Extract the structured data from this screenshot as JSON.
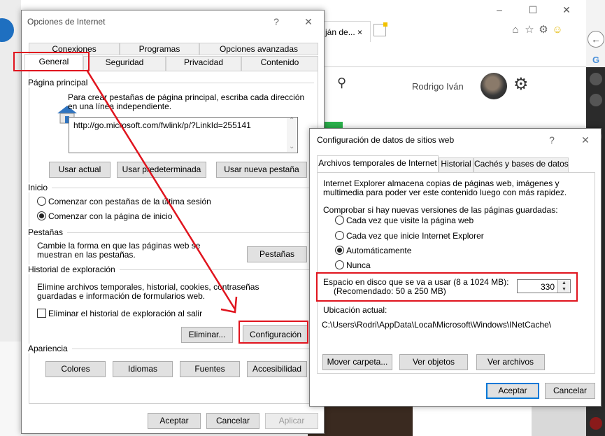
{
  "background": {
    "tab_label": "ján de... ×",
    "user_name": "Rodrigo Iván",
    "window_controls": {
      "minimize": "–",
      "maximize": "☐",
      "close": "✕"
    },
    "toolbar_icons": [
      "home-icon",
      "star-icon",
      "gear-icon",
      "smiley-icon"
    ]
  },
  "internet_options": {
    "title": "Opciones de Internet",
    "help": "?",
    "close": "✕",
    "tabs_row1": [
      "Conexiones",
      "Programas",
      "Opciones avanzadas"
    ],
    "tabs_row2": [
      "General",
      "Seguridad",
      "Privacidad",
      "Contenido"
    ],
    "home": {
      "group": "Página principal",
      "description_line1": "Para crear pestañas de página principal, escriba cada dirección",
      "description_line2": "en una línea independiente.",
      "url": "http://go.microsoft.com/fwlink/p/?LinkId=255141",
      "btn_current": "Usar actual",
      "btn_default": "Usar predeterminada",
      "btn_new_tab": "Usar nueva pestaña"
    },
    "startup": {
      "group": "Inicio",
      "option_last": "Comenzar con pestañas de la última sesión",
      "option_home": "Comenzar con la página de inicio"
    },
    "tabs_section": {
      "group": "Pestañas",
      "description_line1": "Cambie la forma en que las páginas web se",
      "description_line2": "muestran en las pestañas.",
      "btn": "Pestañas"
    },
    "history": {
      "group": "Historial de exploración",
      "description_line1": "Elimine archivos temporales, historial, cookies, contraseñas",
      "description_line2": "guardadas e información de formularios web.",
      "checkbox": "Eliminar el historial de exploración al salir",
      "btn_delete": "Eliminar...",
      "btn_settings": "Configuración"
    },
    "appearance": {
      "group": "Apariencia",
      "btn_colors": "Colores",
      "btn_languages": "Idiomas",
      "btn_fonts": "Fuentes",
      "btn_accessibility": "Accesibilidad"
    },
    "footer": {
      "ok": "Aceptar",
      "cancel": "Cancelar",
      "apply": "Aplicar"
    }
  },
  "website_data": {
    "title": "Configuración de datos de sitios web",
    "help": "?",
    "close": "✕",
    "tabs": [
      "Archivos temporales de Internet",
      "Historial",
      "Cachés y bases de datos"
    ],
    "intro_line1": "Internet Explorer almacena copias de páginas web, imágenes y",
    "intro_line2": "multimedia para poder ver este contenido luego con más rapidez.",
    "check_label": "Comprobar si hay nuevas versiones de las páginas guardadas:",
    "options": [
      "Cada vez que visite la página web",
      "Cada vez que inicie Internet Explorer",
      "Automáticamente",
      "Nunca"
    ],
    "selected_option": "Automáticamente",
    "disk_label_line1": "Espacio en disco que se va a usar (8 a 1024 MB):",
    "disk_label_line2": "(Recomendado: 50 a 250 MB)",
    "disk_value": "330",
    "location_label": "Ubicación actual:",
    "location_path": "C:\\Users\\Rodri\\AppData\\Local\\Microsoft\\Windows\\INetCache\\",
    "btn_move": "Mover carpeta...",
    "btn_objects": "Ver objetos",
    "btn_files": "Ver archivos",
    "footer": {
      "ok": "Aceptar",
      "cancel": "Cancelar"
    }
  },
  "annotation_color": "#e0141e"
}
